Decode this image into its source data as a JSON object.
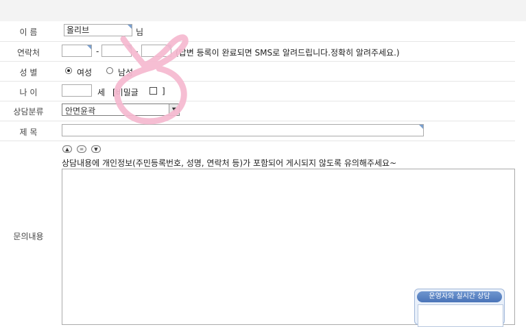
{
  "form": {
    "name": {
      "label": "이 름",
      "value": "올리브",
      "suffix": "님"
    },
    "phone": {
      "label": "연락처",
      "dash1": "-",
      "dash2": "-",
      "notice": "(답변 등록이 완료되면 SMS로 알려드립니다.정확히 알려주세요.)"
    },
    "gender": {
      "label": "성 별",
      "option1": "여성",
      "option2": "남성",
      "selected": "여성"
    },
    "age": {
      "label": "나 이",
      "unit": "세",
      "secret_open": "[비밀글",
      "secret_close": "]"
    },
    "category": {
      "label": "상담분류",
      "selected": "안면윤곽"
    },
    "subject": {
      "label": "제 목",
      "value": ""
    },
    "content": {
      "label": "문의내용",
      "notice": "상담내용에 개인정보(주민등록번호, 성명, 연락처 등)가 포함되어 게시되지 않도록 유의해주세요~",
      "value": ""
    }
  },
  "chat_widget": {
    "title": "운영자와 실시간 상담"
  },
  "annotation": {
    "color": "#f5b8cf",
    "shape": "hand-drawn circle"
  }
}
